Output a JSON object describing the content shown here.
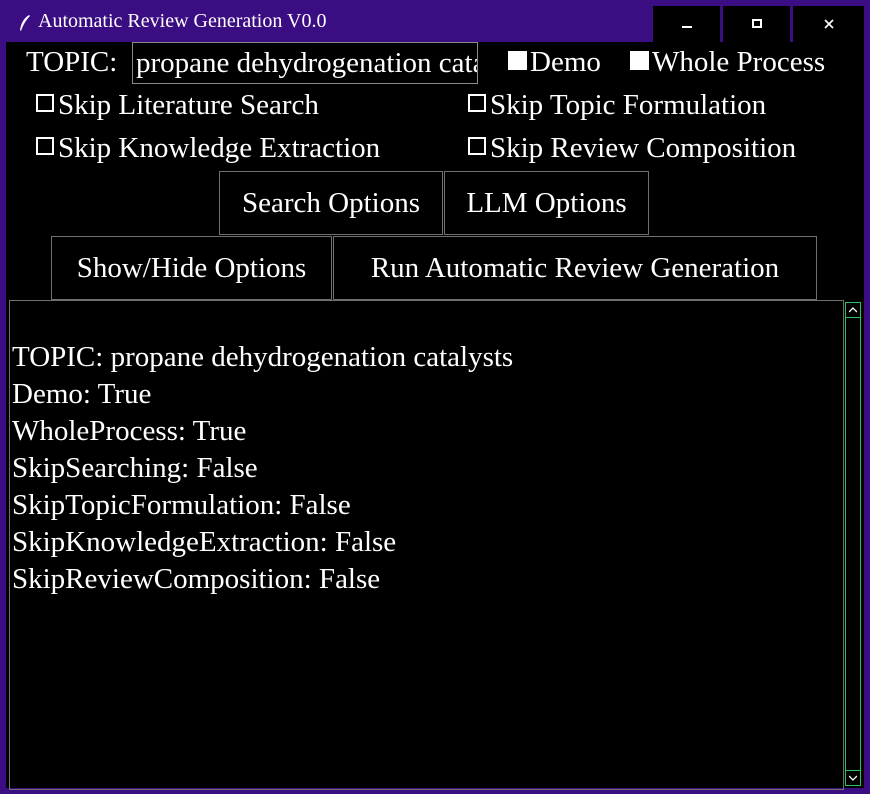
{
  "window": {
    "title": "Automatic Review Generation V0.0",
    "minimize_glyph": "—",
    "maximize_glyph": "□",
    "close_glyph": "✕"
  },
  "options": {
    "topic_label": "TOPIC:",
    "topic_value": "propane dehydrogenation catalysts",
    "demo_label": "Demo",
    "demo_checked": true,
    "whole_process_label": "Whole Process",
    "whole_process_checked": true,
    "skip_literature_search_label": "Skip Literature Search",
    "skip_topic_formulation_label": "Skip Topic Formulation",
    "skip_knowledge_extraction_label": "Skip Knowledge Extraction",
    "skip_review_composition_label": "Skip Review Composition"
  },
  "buttons": {
    "search_options": "Search Options",
    "llm_options": "LLM Options",
    "show_hide_options": "Show/Hide Options",
    "run": "Run Automatic Review Generation"
  },
  "output": {
    "lines": "TOPIC: propane dehydrogenation catalysts\nDemo: True\nWholeProcess: True\nSkipSearching: False\nSkipTopicFormulation: False\nSkipKnowledgeExtraction: False\nSkipReviewComposition: False"
  },
  "colors": {
    "title_bar": "#3b0d82",
    "background": "#000000",
    "text": "#ffffff",
    "scrollbar_accent": "#22c55e"
  }
}
